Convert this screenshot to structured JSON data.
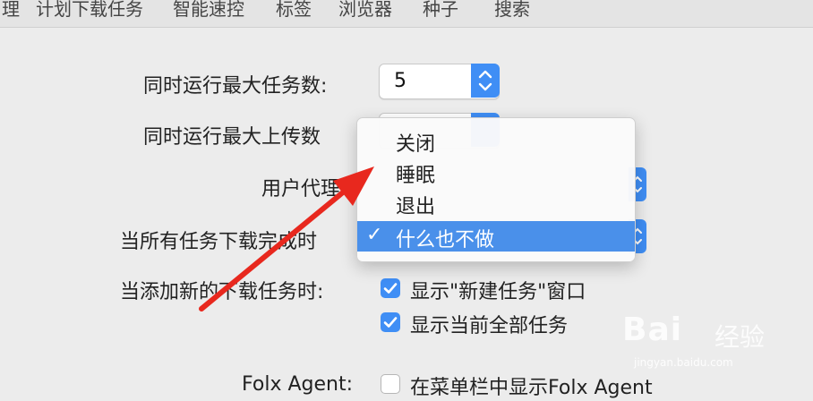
{
  "toolbar": {
    "tabs": [
      "理",
      "计划下载任务",
      "智能速控",
      "标签",
      "浏览器",
      "种子",
      "搜索"
    ]
  },
  "settings": {
    "max_tasks_label": "同时运行最大任务数:",
    "max_tasks_value": "5",
    "max_uploads_label": "同时运行最大上传数",
    "user_agent_label": "用户代理",
    "on_complete_label": "当所有任务下载完成时",
    "on_add_label": "当添加新的下载任务时:",
    "show_new_task_window": "显示\"新建任务\"窗口",
    "show_all_tasks": "显示当前全部任务",
    "folx_agent_label": "Folx Agent:",
    "show_in_menubar": "在菜单栏中显示Folx Agent"
  },
  "menu": {
    "items": [
      "关闭",
      "睡眠",
      "退出",
      "什么也不做"
    ],
    "selected_index": 3,
    "check_glyph": "✓"
  },
  "watermark": {
    "logo": "Bai",
    "brand": "经验",
    "url": "jingyan.baidu.com"
  },
  "colors": {
    "accent": "#3f8ef5",
    "selection": "#4a90ea",
    "arrow": "#e8281e"
  }
}
